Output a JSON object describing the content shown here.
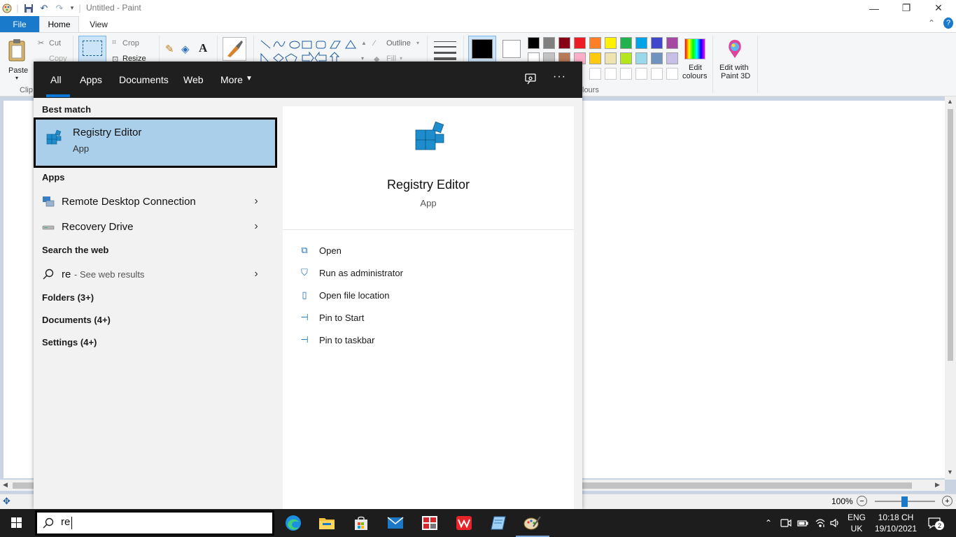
{
  "paint": {
    "title": "Untitled - Paint",
    "tabs": {
      "file": "File",
      "home": "Home",
      "view": "View"
    },
    "ribbon": {
      "paste": "Paste",
      "cut": "Cut",
      "copy": "Copy",
      "clipboard_group": "Clip",
      "crop": "Crop",
      "resize": "Resize",
      "outline": "Outline",
      "fill": "Fill",
      "edit_colours_1": "Edit",
      "edit_colours_2": "colours",
      "colours_group": "lours",
      "paint3d_1": "Edit with",
      "paint3d_2": "Paint 3D"
    },
    "palette_row1": [
      "#000000",
      "#7f7f7f",
      "#880015",
      "#ed1c24",
      "#ff7f27",
      "#fff200",
      "#22b14c",
      "#00a2e8",
      "#3f48cc",
      "#a349a4"
    ],
    "palette_row2": [
      "#ffffff",
      "#c3c3c3",
      "#b97a57",
      "#ffaec9",
      "#ffc90e",
      "#efe4b0",
      "#b5e61d",
      "#99d9ea",
      "#7092be",
      "#c8bfe7"
    ],
    "zoom": "100%"
  },
  "search": {
    "tabs": [
      "All",
      "Apps",
      "Documents",
      "Web",
      "More"
    ],
    "best_match_heading": "Best match",
    "best_match": {
      "name": "Registry Editor",
      "type": "App"
    },
    "apps_heading": "Apps",
    "apps": [
      "Remote Desktop Connection",
      "Recovery Drive"
    ],
    "web_heading": "Search the web",
    "web_query": "re",
    "web_suffix": " - See web results",
    "folders": "Folders (3+)",
    "documents": "Documents (4+)",
    "settings": "Settings (4+)",
    "detail": {
      "name": "Registry Editor",
      "type": "App",
      "actions": [
        "Open",
        "Run as administrator",
        "Open file location",
        "Pin to Start",
        "Pin to taskbar"
      ]
    },
    "query": "re"
  },
  "taskbar": {
    "lang1": "ENG",
    "lang2": "UK",
    "time": "10:18 CH",
    "date": "19/10/2021",
    "notifications": "2"
  }
}
